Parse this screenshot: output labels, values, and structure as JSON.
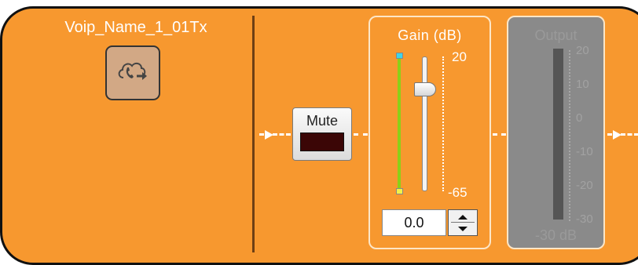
{
  "channel": {
    "name": "Voip_Name_1_01Tx",
    "icon": "cloud-phone-icon"
  },
  "mute": {
    "label": "Mute",
    "active": false,
    "led_color": "#3b0606"
  },
  "gain": {
    "title": "Gain  (dB)",
    "max_label": "20",
    "min_label": "-65",
    "value": "0.0",
    "level_bar_color": "#8bd018"
  },
  "output": {
    "title": "Output",
    "scale_labels": [
      "20",
      "10",
      "0",
      "-10",
      "-20",
      "-30"
    ],
    "readout": "-30  dB",
    "enabled": false
  },
  "colors": {
    "panel": "#f7982f",
    "signal_line": "#ffffff",
    "disabled": "#8a8a8a"
  }
}
